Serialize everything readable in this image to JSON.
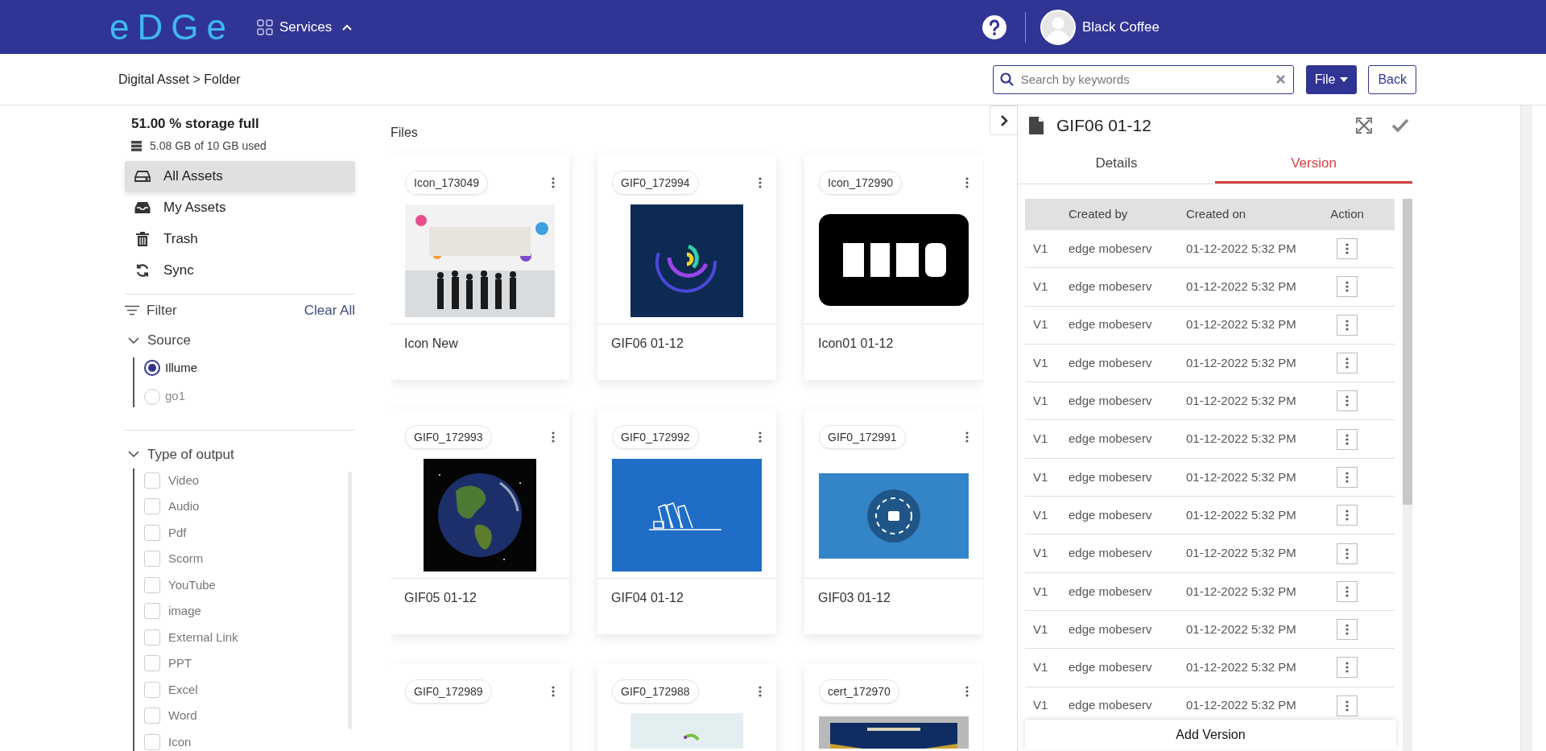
{
  "header": {
    "logo": "eDGe",
    "services_label": "Services",
    "user_name": "Black Coffee"
  },
  "breadcrumb": "Digital Asset > Folder",
  "search": {
    "placeholder": "Search by keywords"
  },
  "actions": {
    "file_button": "File",
    "back_button": "Back"
  },
  "sidebar": {
    "storage_title": "51.00 % storage full",
    "storage_detail": "5.08 GB of 10 GB used",
    "items": [
      {
        "label": "All Assets",
        "selected": true
      },
      {
        "label": "My Assets",
        "selected": false
      },
      {
        "label": "Trash",
        "selected": false
      },
      {
        "label": "Sync",
        "selected": false
      }
    ],
    "filter_label": "Filter",
    "clear_all": "Clear All",
    "source": {
      "title": "Source",
      "expanded": true,
      "options": [
        {
          "label": "Illume",
          "selected": true
        },
        {
          "label": "go1",
          "selected": false
        }
      ]
    },
    "output_type": {
      "title": "Type of output",
      "expanded": true,
      "options": [
        {
          "label": "Video",
          "checked": false
        },
        {
          "label": "Audio",
          "checked": false
        },
        {
          "label": "Pdf",
          "checked": false
        },
        {
          "label": "Scorm",
          "checked": false
        },
        {
          "label": "YouTube",
          "checked": false
        },
        {
          "label": "image",
          "checked": false
        },
        {
          "label": "External Link",
          "checked": false
        },
        {
          "label": "PPT",
          "checked": false
        },
        {
          "label": "Excel",
          "checked": false
        },
        {
          "label": "Word",
          "checked": false
        },
        {
          "label": "Icon",
          "checked": false
        }
      ]
    }
  },
  "files": {
    "title": "Files",
    "cards": [
      {
        "tag": "Icon_173049",
        "name": "Icon New",
        "kind": "picture"
      },
      {
        "tag": "GIF0_172994",
        "name": "GIF06 01-12",
        "kind": "picture"
      },
      {
        "tag": "Icon_172990",
        "name": "Icon01 01-12",
        "kind": "picture"
      },
      {
        "tag": "GIF0_172993",
        "name": "GIF05 01-12",
        "kind": "picture"
      },
      {
        "tag": "GIF0_172992",
        "name": "GIF04 01-12",
        "kind": "picture"
      },
      {
        "tag": "GIF0_172991",
        "name": "GIF03 01-12",
        "kind": "picture"
      },
      {
        "tag": "GIF0_172989",
        "kind": "blank"
      },
      {
        "tag": "GIF0_172988",
        "kind": "picture"
      },
      {
        "tag": "cert_172970",
        "kind": "picture"
      }
    ]
  },
  "panel": {
    "title": "GIF06 01-12",
    "tabs": [
      {
        "label": "Details",
        "selected": false
      },
      {
        "label": "Version",
        "selected": true
      }
    ],
    "table": {
      "columns": [
        "Created by",
        "Created on",
        "Action"
      ],
      "rows": [
        {
          "version": "V1",
          "created_by": "edge mobeserv",
          "created_on": "01-12-2022 5:32 PM"
        },
        {
          "version": "V1",
          "created_by": "edge mobeserv",
          "created_on": "01-12-2022 5:32 PM"
        },
        {
          "version": "V1",
          "created_by": "edge mobeserv",
          "created_on": "01-12-2022 5:32 PM"
        },
        {
          "version": "V1",
          "created_by": "edge mobeserv",
          "created_on": "01-12-2022 5:32 PM"
        },
        {
          "version": "V1",
          "created_by": "edge mobeserv",
          "created_on": "01-12-2022 5:32 PM"
        },
        {
          "version": "V1",
          "created_by": "edge mobeserv",
          "created_on": "01-12-2022 5:32 PM"
        },
        {
          "version": "V1",
          "created_by": "edge mobeserv",
          "created_on": "01-12-2022 5:32 PM"
        },
        {
          "version": "V1",
          "created_by": "edge mobeserv",
          "created_on": "01-12-2022 5:32 PM"
        },
        {
          "version": "V1",
          "created_by": "edge mobeserv",
          "created_on": "01-12-2022 5:32 PM"
        },
        {
          "version": "V1",
          "created_by": "edge mobeserv",
          "created_on": "01-12-2022 5:32 PM"
        },
        {
          "version": "V1",
          "created_by": "edge mobeserv",
          "created_on": "01-12-2022 5:32 PM"
        },
        {
          "version": "V1",
          "created_by": "edge mobeserv",
          "created_on": "01-12-2022 5:32 PM"
        },
        {
          "version": "V1",
          "created_by": "edge mobeserv",
          "created_on": "01-12-2022 5:32 PM"
        }
      ]
    },
    "add_button": "Add Version"
  }
}
